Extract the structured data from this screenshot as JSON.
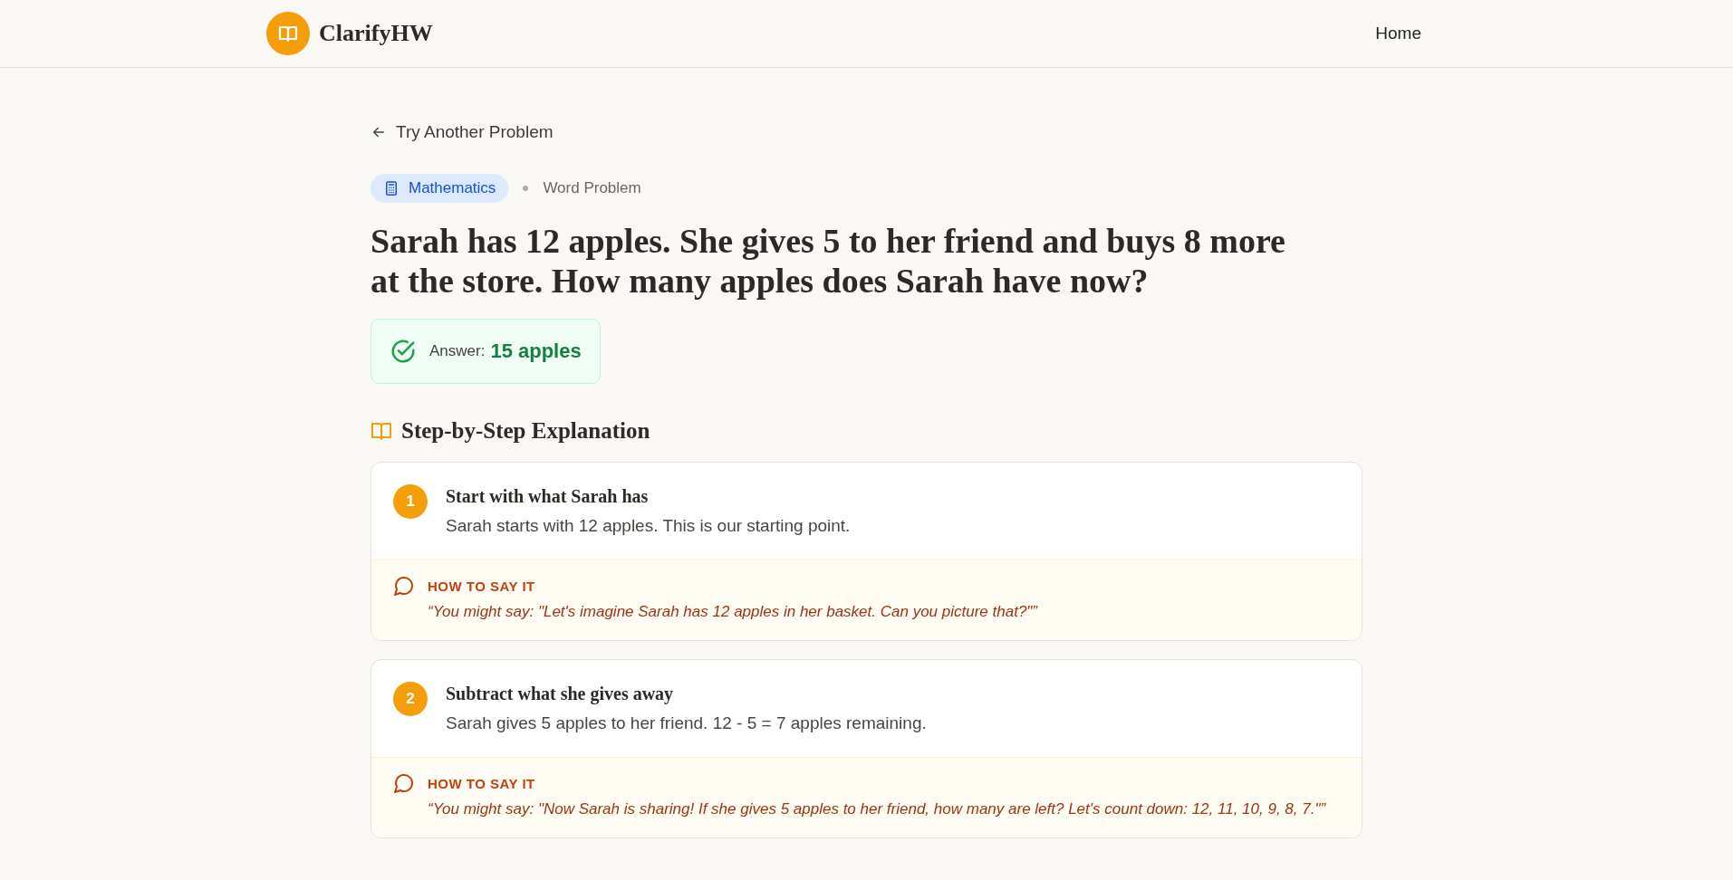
{
  "header": {
    "brand": "ClarifyHW",
    "nav": [
      {
        "label": "Home"
      }
    ]
  },
  "back_link": "Try Another Problem",
  "subject": {
    "label": "Mathematics",
    "type": "Word Problem"
  },
  "problem": "Sarah has 12 apples. She gives 5 to her friend and buys 8 more at the store. How many apples does Sarah have now?",
  "answer": {
    "label": "Answer:",
    "value": "15 apples"
  },
  "section_title": "Step-by-Step Explanation",
  "steps": [
    {
      "number": "1",
      "title": "Start with what Sarah has",
      "text": "Sarah starts with 12 apples. This is our starting point.",
      "tip_label": "HOW TO SAY IT",
      "tip": "“You might say: \"Let's imagine Sarah has 12 apples in her basket. Can you picture that?\"”"
    },
    {
      "number": "2",
      "title": "Subtract what she gives away",
      "text": "Sarah gives 5 apples to her friend. 12 - 5 = 7 apples remaining.",
      "tip_label": "HOW TO SAY IT",
      "tip": "“You might say: \"Now Sarah is sharing! If she gives 5 apples to her friend, how many are left? Let's count down: 12, 11, 10, 9, 8, 7.\"”"
    }
  ]
}
